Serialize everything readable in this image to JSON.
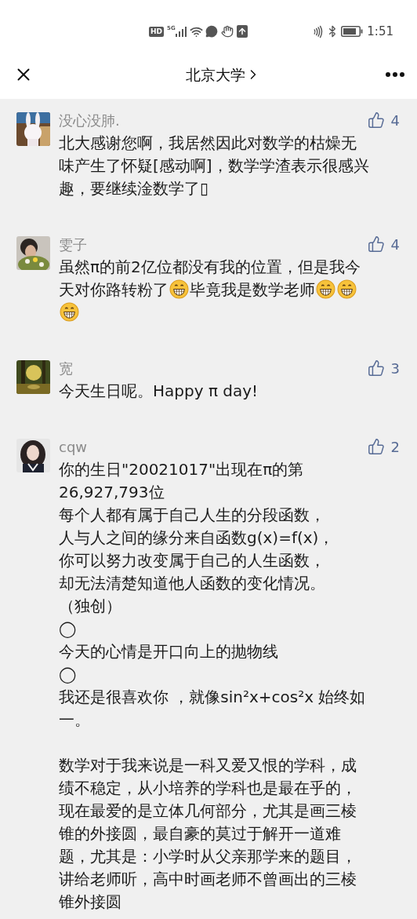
{
  "status_bar": {
    "hd": "HD",
    "network": "5G",
    "time": "1:51"
  },
  "header": {
    "title": "北京大学"
  },
  "comments": [
    {
      "name": "没心没肺.",
      "likes": "4",
      "avatar": {
        "kind": "picture"
      },
      "paragraphs": [
        [
          [
            {
              "kind": "text",
              "text": "北大感谢您啊，我居然因此对数学的枯燥无"
            }
          ],
          [
            {
              "kind": "text",
              "text": "味产生了怀疑[感动啊]，数学学渣表示很感兴"
            }
          ],
          [
            {
              "kind": "text",
              "text": "趣，要继续淦数学了▯"
            }
          ]
        ]
      ]
    },
    {
      "name": "雯子",
      "likes": "4",
      "avatar": {
        "kind": "picture"
      },
      "paragraphs": [
        [
          [
            {
              "kind": "text",
              "text": "虽然π的前2亿位都没有我的位置，但是我今"
            }
          ],
          [
            {
              "kind": "text",
              "text": "天对你路转粉了"
            },
            {
              "kind": "emoji"
            },
            {
              "kind": "text",
              "text": "毕竟我是数学老师"
            },
            {
              "kind": "emoji"
            },
            {
              "kind": "emoji"
            }
          ],
          [
            {
              "kind": "emoji"
            }
          ]
        ]
      ]
    },
    {
      "name": "宽",
      "likes": "3",
      "avatar": {
        "kind": "picture"
      },
      "paragraphs": [
        [
          [
            {
              "kind": "text",
              "text": "今天生日呢。Happy π day!"
            }
          ]
        ]
      ]
    },
    {
      "name": "cqw",
      "likes": "2",
      "avatar": {
        "kind": "picture"
      },
      "paragraphs": [
        [
          [
            {
              "kind": "text",
              "text": "你的生日\"20021017\"出现在π的第"
            }
          ],
          [
            {
              "kind": "text",
              "text": "26,927,793位"
            }
          ],
          [
            {
              "kind": "text",
              "text": "每个人都有属于自己人生的分段函数，"
            }
          ],
          [
            {
              "kind": "text",
              "text": "人与人之间的缘分来自函数g(x)=f(x)，"
            }
          ],
          [
            {
              "kind": "text",
              "text": "你可以努力改变属于自己的人生函数，"
            }
          ],
          [
            {
              "kind": "text",
              "text": "却无法清楚知道他人函数的变化情况。"
            }
          ],
          [
            {
              "kind": "text",
              "text": "（独创）"
            }
          ],
          [
            {
              "kind": "text",
              "text": "◯"
            }
          ],
          [
            {
              "kind": "text",
              "text": "今天的心情是开口向上的抛物线"
            }
          ],
          [
            {
              "kind": "text",
              "text": "◯"
            }
          ],
          [
            {
              "kind": "text",
              "text": "我还是很喜欢你 ，就像sin²x+cos²x 始终如"
            }
          ],
          [
            {
              "kind": "text",
              "text": "一。"
            }
          ]
        ],
        [
          [
            {
              "kind": "text",
              "text": "数学对于我来说是一科又爱又恨的学科，成"
            }
          ],
          [
            {
              "kind": "text",
              "text": "绩不稳定，从小培养的学科也是最在乎的，"
            }
          ],
          [
            {
              "kind": "text",
              "text": "现在最爱的是立体几何部分，尤其是画三棱"
            }
          ],
          [
            {
              "kind": "text",
              "text": "锥的外接圆，最自豪的莫过于解开一道难"
            }
          ],
          [
            {
              "kind": "text",
              "text": "题，尤其是：小学时从父亲那学来的题目，"
            }
          ],
          [
            {
              "kind": "text",
              "text": "讲给老师听，高中时画老师不曾画出的三棱"
            }
          ],
          [
            {
              "kind": "text",
              "text": "锥外接圆"
            }
          ]
        ]
      ]
    }
  ]
}
